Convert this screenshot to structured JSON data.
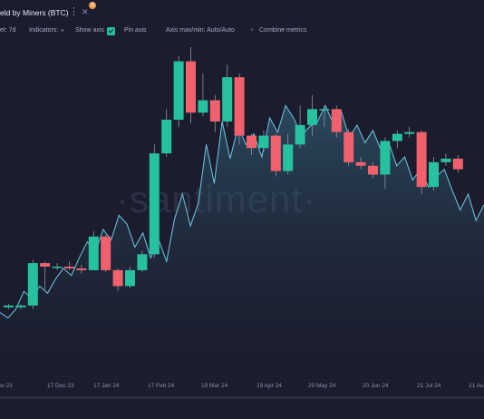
{
  "header": {
    "title": "eld by Miners (BTC)",
    "badge_count": "8",
    "menu_icon": "kebab-icon",
    "close_icon": "close-icon"
  },
  "toolbar": {
    "interval": "et: 7d",
    "indicators": "Indicators:",
    "show_axis": "Show axis",
    "pin_axis": "Pin axis",
    "axis_maxmin": "Axis max/min: Auto/Auto",
    "combine_metrics": "Combine metrics",
    "accent_color": "#26c2a0"
  },
  "watermark": "·santiment·",
  "colors": {
    "up": "#26c2a0",
    "down": "#f0616d",
    "line": "#6fc8e3",
    "background": "#1b1d2e"
  },
  "chart_data": {
    "type": "candlestick",
    "x_ticks": [
      "w 23",
      "17 Dec 23",
      "17 Jan 24",
      "17 Feb 24",
      "19 Mar 24",
      "19 Apr 24",
      "20 May 24",
      "20 Jun 24",
      "21 Jul 24",
      "21 Au"
    ],
    "candles": [
      {
        "o": 198,
        "c": 199,
        "h": 200,
        "l": 197
      },
      {
        "o": 198,
        "c": 199,
        "h": 200,
        "l": 197
      },
      {
        "o": 199,
        "c": 223,
        "h": 225,
        "l": 197
      },
      {
        "o": 223,
        "c": 221,
        "h": 224,
        "l": 208
      },
      {
        "o": 221,
        "c": 221,
        "h": 223,
        "l": 219
      },
      {
        "o": 221,
        "c": 220,
        "h": 224,
        "l": 219
      },
      {
        "o": 220,
        "c": 219,
        "h": 222,
        "l": 217
      },
      {
        "o": 219,
        "c": 238,
        "h": 241,
        "l": 219
      },
      {
        "o": 238,
        "c": 219,
        "h": 239,
        "l": 218
      },
      {
        "o": 219,
        "c": 210,
        "h": 220,
        "l": 207
      },
      {
        "o": 210,
        "c": 219,
        "h": 221,
        "l": 209
      },
      {
        "o": 219,
        "c": 228,
        "h": 230,
        "l": 218
      },
      {
        "o": 228,
        "c": 285,
        "h": 290,
        "l": 226
      },
      {
        "o": 285,
        "c": 304,
        "h": 310,
        "l": 283
      },
      {
        "o": 304,
        "c": 337,
        "h": 340,
        "l": 300
      },
      {
        "o": 337,
        "c": 308,
        "h": 345,
        "l": 302
      },
      {
        "o": 308,
        "c": 315,
        "h": 330,
        "l": 306
      },
      {
        "o": 315,
        "c": 303,
        "h": 318,
        "l": 297
      },
      {
        "o": 303,
        "c": 328,
        "h": 335,
        "l": 300
      },
      {
        "o": 328,
        "c": 295,
        "h": 330,
        "l": 290
      },
      {
        "o": 295,
        "c": 288,
        "h": 296,
        "l": 284
      },
      {
        "o": 288,
        "c": 295,
        "h": 298,
        "l": 286
      },
      {
        "o": 295,
        "c": 275,
        "h": 296,
        "l": 272
      },
      {
        "o": 275,
        "c": 290,
        "h": 296,
        "l": 273
      },
      {
        "o": 290,
        "c": 301,
        "h": 312,
        "l": 288
      },
      {
        "o": 301,
        "c": 310,
        "h": 318,
        "l": 295
      },
      {
        "o": 310,
        "c": 310,
        "h": 312,
        "l": 300
      },
      {
        "o": 310,
        "c": 297,
        "h": 312,
        "l": 294
      },
      {
        "o": 297,
        "c": 280,
        "h": 299,
        "l": 278
      },
      {
        "o": 280,
        "c": 278,
        "h": 283,
        "l": 276
      },
      {
        "o": 278,
        "c": 273,
        "h": 280,
        "l": 271
      },
      {
        "o": 273,
        "c": 292,
        "h": 294,
        "l": 265
      },
      {
        "o": 292,
        "c": 296,
        "h": 298,
        "l": 288
      },
      {
        "o": 296,
        "c": 297,
        "h": 300,
        "l": 294
      },
      {
        "o": 297,
        "c": 266,
        "h": 298,
        "l": 262
      },
      {
        "o": 266,
        "c": 280,
        "h": 283,
        "l": 264
      },
      {
        "o": 280,
        "c": 282,
        "h": 285,
        "l": 278
      },
      {
        "o": 282,
        "c": 276,
        "h": 284,
        "l": 274
      }
    ],
    "line": [
      195,
      192,
      197,
      207,
      203,
      210,
      206,
      214,
      220,
      216,
      226,
      235,
      229,
      242,
      236,
      250,
      245,
      232,
      240,
      226,
      236,
      224,
      248,
      262,
      244,
      257,
      290,
      268,
      303,
      282,
      300,
      290,
      296,
      283,
      305,
      297,
      312,
      305,
      295,
      300,
      303,
      312,
      302,
      309,
      294,
      301,
      291,
      298,
      287,
      291,
      278,
      283,
      270,
      276,
      266,
      272,
      276,
      264,
      253,
      262,
      247,
      256
    ],
    "ylim": [
      180,
      345
    ]
  }
}
